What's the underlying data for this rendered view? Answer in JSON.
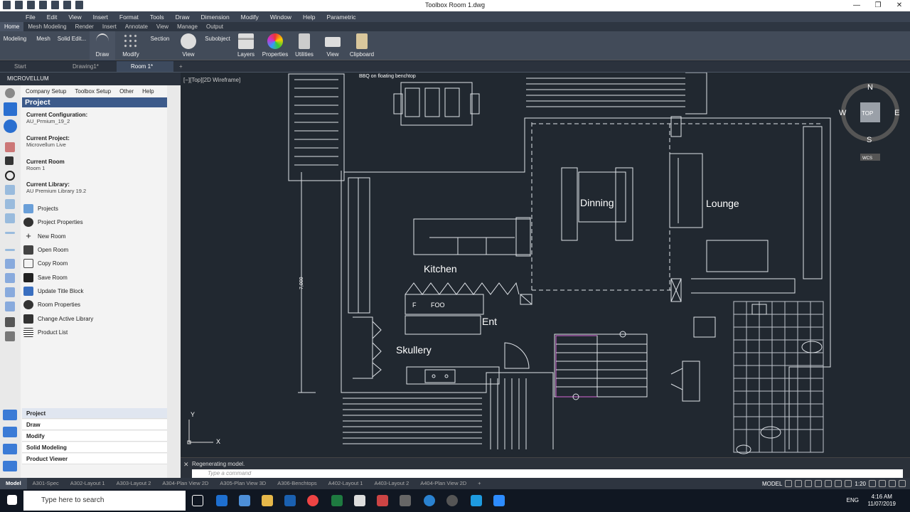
{
  "window": {
    "title": "Toolbox  Room 1.dwg"
  },
  "menu": [
    "File",
    "Edit",
    "View",
    "Insert",
    "Format",
    "Tools",
    "Draw",
    "Dimension",
    "Modify",
    "Window",
    "Help",
    "Parametric"
  ],
  "ribbon_tabs": [
    "Home",
    "Mesh Modeling",
    "Render",
    "Insert",
    "Annotate",
    "View",
    "Manage",
    "Output"
  ],
  "ribbon_small": [
    "Modeling",
    "Mesh",
    "Solid Edit...",
    "Section",
    "Subobject"
  ],
  "ribbon_buttons": [
    "Draw",
    "Modify",
    "View",
    "Layers",
    "Properties",
    "Utilities",
    "View",
    "Clipboard"
  ],
  "doc_tabs": [
    "Start",
    "Drawing1*",
    "Room 1*"
  ],
  "palette": {
    "title": "MICROVELLUM",
    "menu": [
      "Company Setup",
      "Toolbox Setup",
      "Other",
      "Help"
    ],
    "header": "Project",
    "info": [
      {
        "label": "Current Configuration:",
        "value": "AU_Prmium_19_2"
      },
      {
        "label": "Current Project:",
        "value": "Microvellum Live"
      },
      {
        "label": "Current Room",
        "value": "Room 1"
      },
      {
        "label": "Current Library:",
        "value": "AU Premium Library 19.2"
      }
    ],
    "links": [
      "Projects",
      "Project Properties",
      "New Room",
      "Open Room",
      "Copy Room",
      "Save Room",
      "Update Title Block",
      "Room Properties",
      "Change Active Library",
      "Product List"
    ],
    "bottom_tabs": [
      "Project",
      "Draw",
      "Modify",
      "Solid Modeling",
      "Product Viewer"
    ]
  },
  "viewport": {
    "label": "[−][Top][2D Wireframe]"
  },
  "drawing": {
    "rooms": [
      "Dinning",
      "Lounge",
      "Kitchen",
      "Skullery",
      "Ent"
    ],
    "annotations": [
      "BBQ on floating benchtop",
      "F",
      "FOO",
      "7,000"
    ],
    "viewcube": {
      "n": "N",
      "s": "S",
      "e": "E",
      "w": "W",
      "top": "TOP",
      "wcs": "WCS"
    },
    "ucs": {
      "x": "X",
      "y": "Y"
    }
  },
  "command": {
    "history": "Regenerating model.",
    "placeholder": "Type a command"
  },
  "layout_tabs": [
    "Model",
    "A301-Spec",
    "A302-Layout 1",
    "A303-Layout 2",
    "A304-Plan View 2D",
    "A305-Plan View 3D",
    "A306-Benchtops",
    "A402-Layout 1",
    "A403-Layout 2",
    "A404-Plan View 2D"
  ],
  "status": {
    "model": "MODEL",
    "scale": "1:20"
  },
  "taskbar": {
    "search": "Type here to search",
    "lang": "ENG",
    "time": "4:16 AM",
    "date": "11/07/2019"
  }
}
